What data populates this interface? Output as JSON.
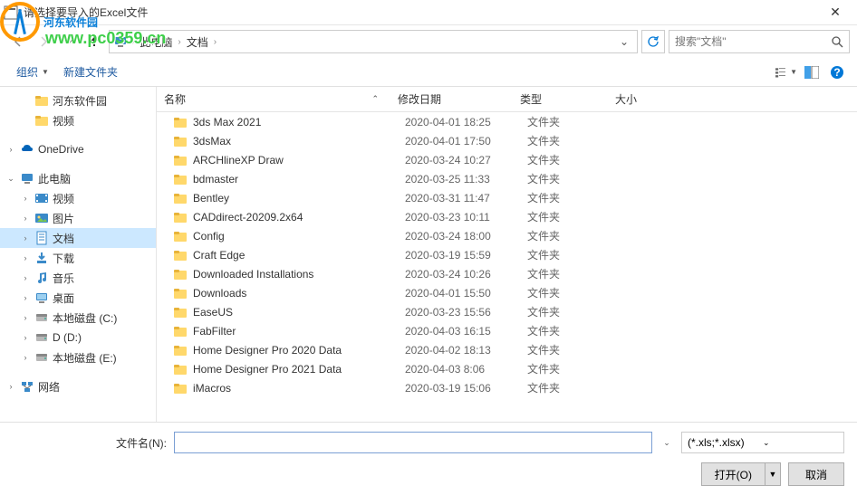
{
  "watermark": {
    "text": "河东软件园",
    "url": "www.pc0359.cn"
  },
  "window": {
    "title": "请选择要导入的Excel文件"
  },
  "breadcrumb": {
    "root": "此电脑",
    "current": "文档"
  },
  "search": {
    "placeholder": "搜索\"文档\""
  },
  "toolbar": {
    "organize": "组织",
    "newfolder": "新建文件夹"
  },
  "headers": {
    "name": "名称",
    "date": "修改日期",
    "type": "类型",
    "size": "大小"
  },
  "sidebar": [
    {
      "label": "河东软件园",
      "icon": "folder",
      "indent": 1
    },
    {
      "label": "视频",
      "icon": "folder",
      "indent": 1,
      "gap": true
    },
    {
      "label": "OneDrive",
      "icon": "onedrive",
      "indent": 0,
      "exp": ">",
      "gap": true
    },
    {
      "label": "此电脑",
      "icon": "pc",
      "indent": 0,
      "exp": "v"
    },
    {
      "label": "视频",
      "icon": "video",
      "indent": 1,
      "exp": ">"
    },
    {
      "label": "图片",
      "icon": "pictures",
      "indent": 1,
      "exp": ">"
    },
    {
      "label": "文档",
      "icon": "docs",
      "indent": 1,
      "exp": ">",
      "selected": true
    },
    {
      "label": "下载",
      "icon": "downloads",
      "indent": 1,
      "exp": ">"
    },
    {
      "label": "音乐",
      "icon": "music",
      "indent": 1,
      "exp": ">"
    },
    {
      "label": "桌面",
      "icon": "desktop",
      "indent": 1,
      "exp": ">"
    },
    {
      "label": "本地磁盘 (C:)",
      "icon": "disk",
      "indent": 1,
      "exp": ">"
    },
    {
      "label": "D (D:)",
      "icon": "disk",
      "indent": 1,
      "exp": ">"
    },
    {
      "label": "本地磁盘 (E:)",
      "icon": "disk",
      "indent": 1,
      "exp": ">",
      "gap": true
    },
    {
      "label": "网络",
      "icon": "network",
      "indent": 0,
      "exp": ">"
    }
  ],
  "files": [
    {
      "name": "3ds Max 2021",
      "date": "2020-04-01 18:25",
      "type": "文件夹"
    },
    {
      "name": "3dsMax",
      "date": "2020-04-01 17:50",
      "type": "文件夹"
    },
    {
      "name": "ARCHlineXP Draw",
      "date": "2020-03-24 10:27",
      "type": "文件夹"
    },
    {
      "name": "bdmaster",
      "date": "2020-03-25 11:33",
      "type": "文件夹"
    },
    {
      "name": "Bentley",
      "date": "2020-03-31 11:47",
      "type": "文件夹"
    },
    {
      "name": "CADdirect-20209.2x64",
      "date": "2020-03-23 10:11",
      "type": "文件夹"
    },
    {
      "name": "Config",
      "date": "2020-03-24 18:00",
      "type": "文件夹"
    },
    {
      "name": "Craft Edge",
      "date": "2020-03-19 15:59",
      "type": "文件夹"
    },
    {
      "name": "Downloaded Installations",
      "date": "2020-03-24 10:26",
      "type": "文件夹"
    },
    {
      "name": "Downloads",
      "date": "2020-04-01 15:50",
      "type": "文件夹"
    },
    {
      "name": "EaseUS",
      "date": "2020-03-23 15:56",
      "type": "文件夹"
    },
    {
      "name": "FabFilter",
      "date": "2020-04-03 16:15",
      "type": "文件夹"
    },
    {
      "name": "Home Designer Pro 2020 Data",
      "date": "2020-04-02 18:13",
      "type": "文件夹"
    },
    {
      "name": "Home Designer Pro 2021 Data",
      "date": "2020-04-03 8:06",
      "type": "文件夹"
    },
    {
      "name": "iMacros",
      "date": "2020-03-19 15:06",
      "type": "文件夹"
    }
  ],
  "footer": {
    "filename_label": "文件名(N):",
    "filter": "(*.xls;*.xlsx)",
    "open": "打开(O)",
    "cancel": "取消"
  }
}
